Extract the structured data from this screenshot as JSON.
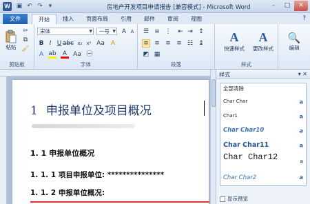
{
  "app": {
    "title": "房地产开发项目申请报告 [兼容模式] - Microsoft Word",
    "logo_letter": "W"
  },
  "quick_access": [
    "save-icon",
    "undo-icon",
    "redo-icon",
    "customize-icon"
  ],
  "window_controls": {
    "minimize": "–",
    "maximize": "□",
    "close": "✕"
  },
  "tabs": [
    {
      "label": "文件",
      "id": "file"
    },
    {
      "label": "开始",
      "id": "home"
    },
    {
      "label": "插入",
      "id": "insert"
    },
    {
      "label": "页面布局",
      "id": "layout"
    },
    {
      "label": "引用",
      "id": "references"
    },
    {
      "label": "邮件",
      "id": "mailings"
    },
    {
      "label": "审阅",
      "id": "review"
    },
    {
      "label": "视图",
      "id": "view"
    }
  ],
  "help_icon": "?",
  "ribbon": {
    "clipboard": {
      "paste_label": "粘贴",
      "group_label": "剪贴板"
    },
    "font": {
      "font_name": "宋体",
      "font_size": "一号",
      "group_label": "字体"
    },
    "paragraph": {
      "group_label": "段落"
    },
    "styles": {
      "group_label": "样式",
      "quick_styles_label": "快速样式",
      "change_styles_label": "更改样式"
    },
    "editing": {
      "label": "编辑"
    }
  },
  "document": {
    "heading1_number": "1",
    "heading1_text": "申报单位及项目概况",
    "heading2": "1. 1   申报单位概况",
    "heading3a": "1. 1. 1 项目申报单位: ***************",
    "heading3b": "1. 1. 2 申报单位概况:"
  },
  "styles_pane": {
    "title": "样式",
    "controls": "▾ ✕",
    "items": [
      {
        "label": "全部清除",
        "mark": ""
      },
      {
        "label": "Char Char",
        "mark": "a"
      },
      {
        "label": "Char1",
        "mark": "a"
      },
      {
        "label": "Char Char10",
        "mark": "a"
      },
      {
        "label": "Char Char11",
        "mark": "a"
      },
      {
        "label": "Char Char12",
        "mark": "a"
      },
      {
        "label": "Char Char2",
        "mark": "a"
      }
    ],
    "footer_label": "显示预览"
  },
  "colors": {
    "accent": "#2b5797",
    "heading_blue": "#1f3a6e",
    "red_line": "#e03030"
  }
}
